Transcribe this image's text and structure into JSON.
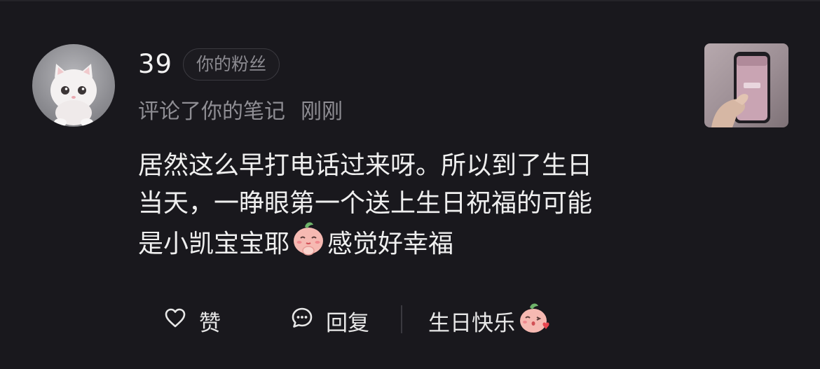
{
  "notification": {
    "username": "39",
    "badge": "你的粉丝",
    "action_text": "评论了你的笔记",
    "time": "刚刚",
    "comment_lines": [
      "居然这么早打电话过来呀。所以到了生日",
      "当天，一睁眼第一个送上生日祝福的可能",
      "是小凯宝宝耶"
    ],
    "comment_tail": "感觉好幸福"
  },
  "actions": {
    "like_label": "赞",
    "reply_label": "回复",
    "quick_reply_label": "生日快乐"
  },
  "icons": {
    "like": "heart-outline-icon",
    "reply": "chat-bubble-icon",
    "emoji_inline": "peach-praying-emoji",
    "emoji_quick": "peach-kiss-emoji"
  },
  "colors": {
    "background": "#19181d",
    "primary_text": "#efefef",
    "secondary_text": "#8f8e94"
  }
}
